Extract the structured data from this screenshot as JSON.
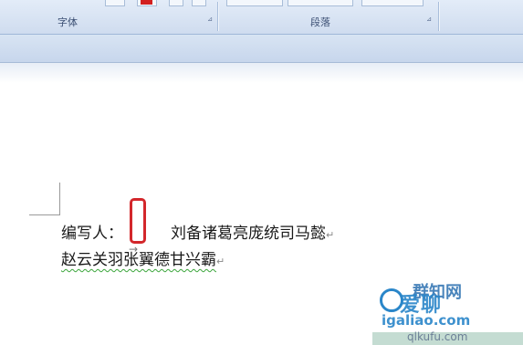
{
  "ribbon": {
    "groups": [
      {
        "label": "字体"
      },
      {
        "label": "段落"
      }
    ],
    "launcher_glyph": "⊿"
  },
  "document": {
    "line1": {
      "label": "编写人：",
      "tab_glyph": "→",
      "names": "刘备诸葛亮庞统司马懿",
      "para_mark": "↵"
    },
    "line2": {
      "names": "赵云关羽张翼德甘兴霸",
      "para_mark": "↵"
    }
  },
  "watermark": {
    "top": "群知网",
    "big": "爱聊",
    "url": "igaliao.com",
    "bottom": "qlkufu.com"
  },
  "colors": {
    "ribbon": "#d5e2f2",
    "highlight_box": "#d3272b",
    "watermark": "#2a86c9"
  }
}
